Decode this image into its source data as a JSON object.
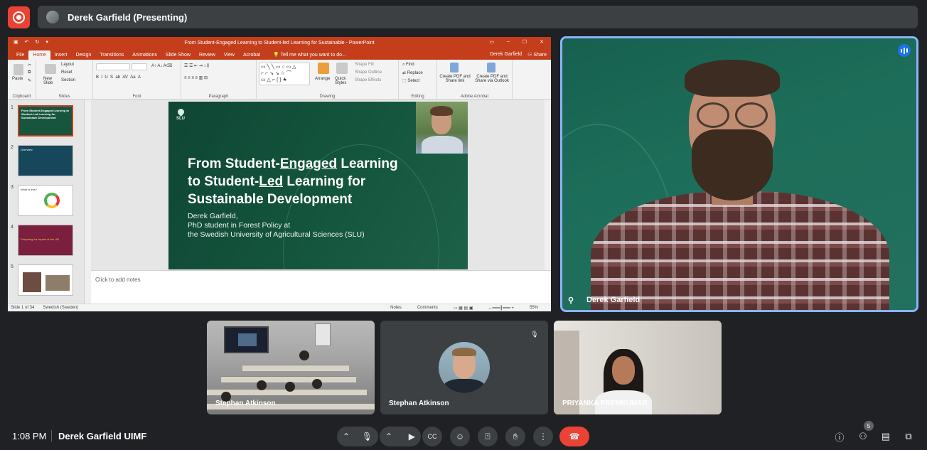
{
  "topbar": {
    "presenting_title": "Derek Garfield (Presenting)"
  },
  "ppt": {
    "window_title": "From Student-Engaged Learning to Student-led Learning for Sustainable - PowerPoint",
    "tabs": [
      "File",
      "Home",
      "Insert",
      "Design",
      "Transitions",
      "Animations",
      "Slide Show",
      "Review",
      "View",
      "Acrobat"
    ],
    "tell_me": "Tell me what you want to do...",
    "user": "Derek Garfield",
    "share": "Share",
    "ribbon": {
      "paste": "Paste",
      "new_slide": "New Slide",
      "layout": "Layout",
      "reset": "Reset",
      "section": "Section",
      "arrange": "Arrange",
      "quick_styles": "Quick Styles",
      "shape_fill": "Shape Fill",
      "shape_outline": "Shape Outline",
      "shape_effects": "Shape Effects",
      "find": "Find",
      "replace": "Replace",
      "select": "Select",
      "create_pdf_share": "Create PDF and Share link",
      "create_pdf_outlook": "Create PDF and Share via Outlook",
      "groups": [
        "Clipboard",
        "Slides",
        "Font",
        "Paragraph",
        "Drawing",
        "Editing",
        "Adobe Acrobat"
      ]
    },
    "thumbnails": [
      {
        "num": "1",
        "title": "From Student-Engaged Learning to Student-Led Learning for Sustainable Development"
      },
      {
        "num": "2",
        "title": "Overview"
      },
      {
        "num": "3",
        "title": "What is this?"
      },
      {
        "num": "4",
        "title": "Preparing for impact at the UN"
      },
      {
        "num": "5",
        "title": ""
      }
    ],
    "slide": {
      "logo": "SLU",
      "title_line1_a": "From Student-",
      "title_line1_b": "Engaged",
      "title_line1_c": " Learning",
      "title_line2_a": "to Student-",
      "title_line2_b": "Led",
      "title_line2_c": " Learning for",
      "title_line3": "Sustainable Development",
      "author_line1": "Derek Garfield,",
      "author_line2": "PhD student in Forest Policy at",
      "author_line3": "the Swedish University of Agricultural Sciences (SLU)"
    },
    "notes_placeholder": "Click to add notes",
    "status": {
      "slide_count": "Slide 1 of 34",
      "language": "Swedish (Sweden)",
      "notes": "Notes",
      "comments": "Comments",
      "zoom": "55%"
    }
  },
  "speaker": {
    "name": "Derek Garfield"
  },
  "tiles": [
    {
      "name": "Stephan Atkinson"
    },
    {
      "name": "Stephan Atkinson"
    },
    {
      "name": "PRIYANKA PREMKUMAR"
    }
  ],
  "bottombar": {
    "time": "1:08 PM",
    "meeting": "Derek Garfield UIMF",
    "people_count": "5"
  }
}
